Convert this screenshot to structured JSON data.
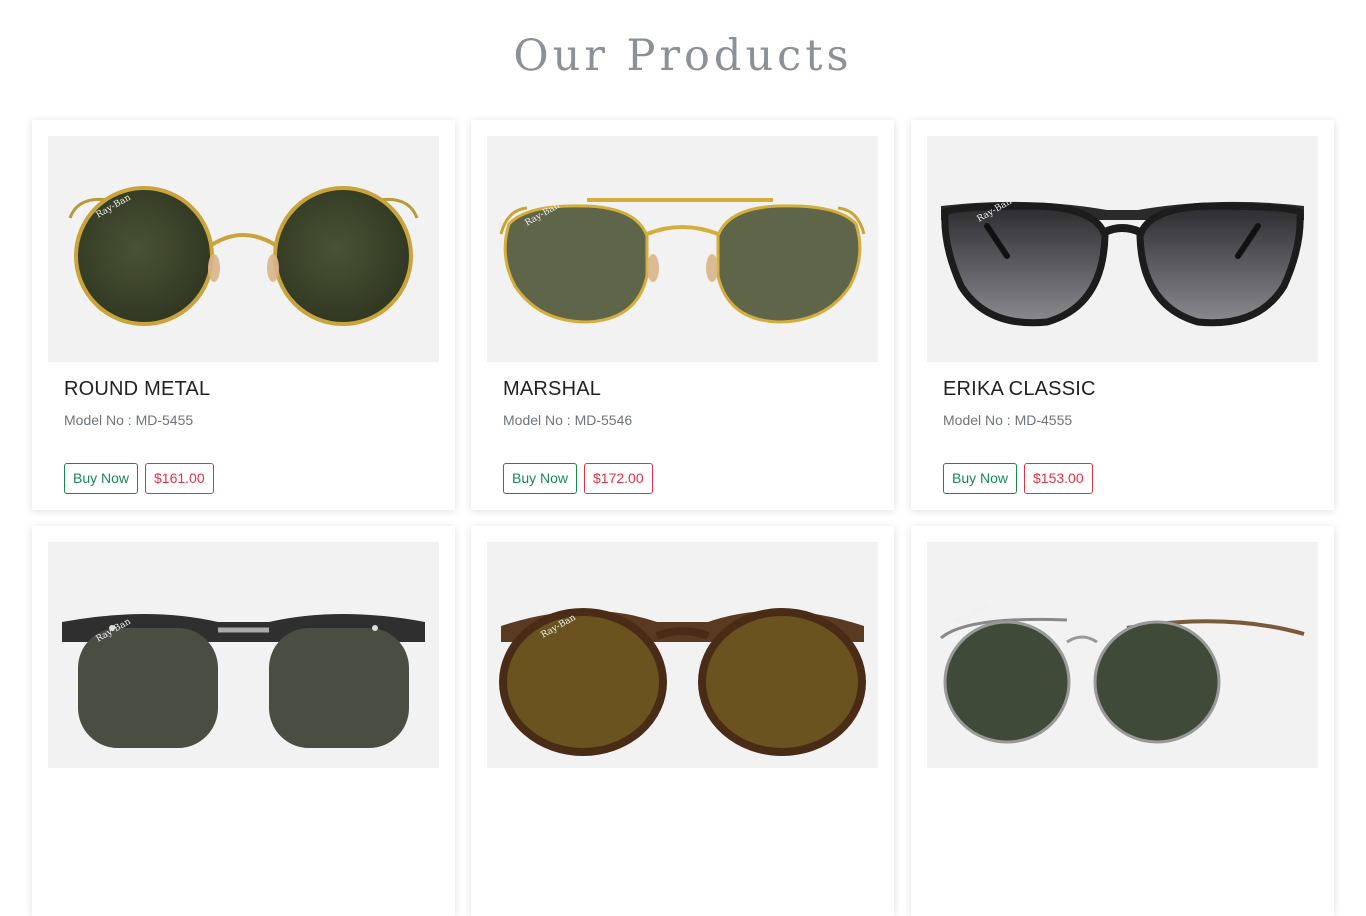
{
  "page": {
    "title": "Our Products"
  },
  "products": [
    {
      "name": "ROUND METAL",
      "model": "Model No : MD-5455",
      "buy_label": "Buy Now",
      "price": "$161.00",
      "image": "round-metal-sunglasses"
    },
    {
      "name": "MARSHAL",
      "model": "Model No : MD-5546",
      "buy_label": "Buy Now",
      "price": "$172.00",
      "image": "marshal-sunglasses"
    },
    {
      "name": "ERIKA CLASSIC",
      "model": "Model No : MD-4555",
      "buy_label": "Buy Now",
      "price": "$153.00",
      "image": "erika-classic-sunglasses"
    },
    {
      "name": "",
      "model": "",
      "buy_label": "",
      "price": "",
      "image": "clubmaster-sunglasses"
    },
    {
      "name": "",
      "model": "",
      "buy_label": "",
      "price": "",
      "image": "tortoise-round-sunglasses"
    },
    {
      "name": "",
      "model": "",
      "buy_label": "",
      "price": "",
      "image": "aviator-sunglasses"
    }
  ],
  "colors": {
    "buy": "#198754",
    "price": "#dc3545",
    "title": "#8a9199",
    "image_bg": "#f2f2f2"
  }
}
